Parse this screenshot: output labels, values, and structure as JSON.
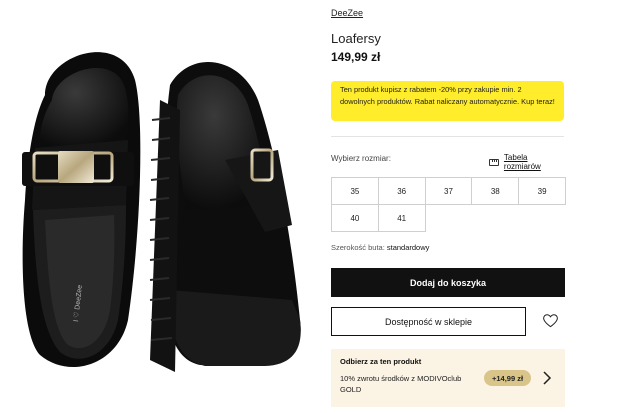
{
  "product": {
    "brand": "DeeZee",
    "title": "Loafersy",
    "price": "149,99 zł",
    "insole_logo": "I ♡ DeeZee"
  },
  "promo": {
    "text": "Ten produkt kupisz z rabatem -20% przy zakupie min. 2 dowolnych produktów. Rabat naliczany automatycznie. Kup teraz!",
    "bg_color": "#ffec2a"
  },
  "size_picker": {
    "label": "Wybierz rozmiar:",
    "chart_link": "Tabela rozmiarów",
    "sizes": [
      "35",
      "36",
      "37",
      "38",
      "39",
      "40",
      "41"
    ]
  },
  "width": {
    "label": "Szerokość buta:",
    "value": "standardowy"
  },
  "actions": {
    "add_to_cart": "Dodaj do koszyka",
    "availability": "Dostępność w sklepie",
    "wishlist_icon": "heart-icon"
  },
  "cashback": {
    "title": "Odbierz za ten produkt",
    "text": "10% zwrotu środków z MODIVOclub GOLD",
    "amount": "+14,99 zł",
    "bg_color": "#fbf4e4"
  }
}
